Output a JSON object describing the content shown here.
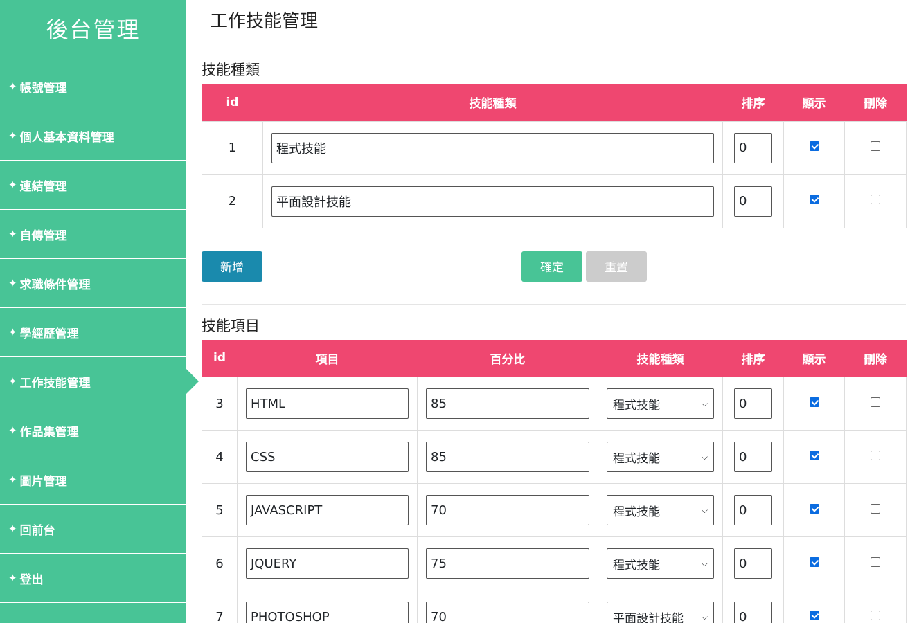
{
  "sidebar": {
    "brand": "後台管理",
    "star": "✦",
    "items": [
      {
        "label": "帳號管理"
      },
      {
        "label": "個人基本資料管理"
      },
      {
        "label": "連結管理"
      },
      {
        "label": "自傳管理"
      },
      {
        "label": "求職條件管理"
      },
      {
        "label": "學經歷管理"
      },
      {
        "label": "工作技能管理"
      },
      {
        "label": "作品集管理"
      },
      {
        "label": "圖片管理"
      },
      {
        "label": "回前台"
      },
      {
        "label": "登出"
      }
    ]
  },
  "page": {
    "title": "工作技能管理"
  },
  "categories": {
    "title": "技能種類",
    "headers": {
      "id": "id",
      "name": "技能種類",
      "order": "排序",
      "show": "顯示",
      "delete": "刪除"
    },
    "rows": [
      {
        "id": "1",
        "name": "程式技能",
        "order": "0",
        "show": true,
        "delete": false
      },
      {
        "id": "2",
        "name": "平面設計技能",
        "order": "0",
        "show": true,
        "delete": false
      }
    ]
  },
  "buttons": {
    "add": "新增",
    "confirm": "確定",
    "reset": "重置"
  },
  "skills": {
    "title": "技能項目",
    "headers": {
      "id": "id",
      "item": "項目",
      "percent": "百分比",
      "category": "技能種類",
      "order": "排序",
      "show": "顯示",
      "delete": "刪除"
    },
    "rows": [
      {
        "id": "3",
        "item": "HTML",
        "percent": "85",
        "category": "程式技能",
        "order": "0",
        "show": true,
        "delete": false
      },
      {
        "id": "4",
        "item": "CSS",
        "percent": "85",
        "category": "程式技能",
        "order": "0",
        "show": true,
        "delete": false
      },
      {
        "id": "5",
        "item": "JAVASCRIPT",
        "percent": "70",
        "category": "程式技能",
        "order": "0",
        "show": true,
        "delete": false
      },
      {
        "id": "6",
        "item": "JQUERY",
        "percent": "75",
        "category": "程式技能",
        "order": "0",
        "show": true,
        "delete": false
      },
      {
        "id": "7",
        "item": "PHOTOSHOP",
        "percent": "70",
        "category": "平面設計技能",
        "order": "0",
        "show": true,
        "delete": false
      }
    ]
  },
  "colors": {
    "sidebar": "#48c496",
    "table_header": "#ef4770",
    "add_button": "#1a8aad",
    "confirm_button": "#48c496",
    "reset_button": "#cccccc",
    "checkbox": "#0b6ce0"
  }
}
